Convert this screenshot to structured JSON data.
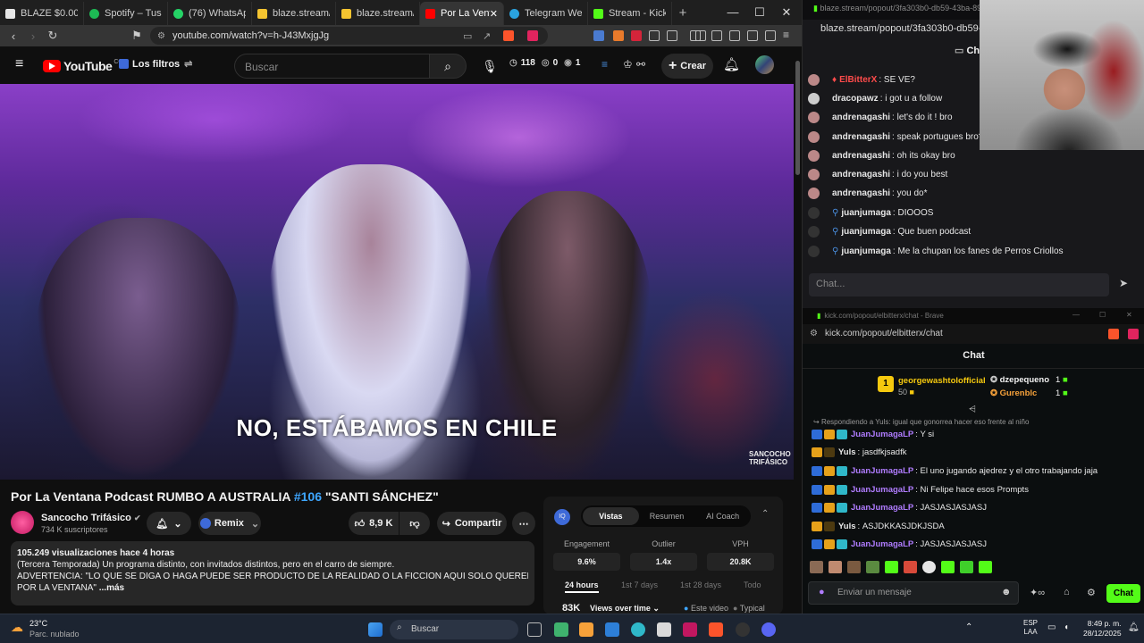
{
  "browser": {
    "tabs": [
      {
        "label": "BLAZE $0.004610",
        "color": "#e6e6e6"
      },
      {
        "label": "Spotify – Tus me",
        "color": "#1db954"
      },
      {
        "label": "(76) WhatsApp",
        "color": "#25d366"
      },
      {
        "label": "blaze.stream/stre",
        "color": "#f4c430"
      },
      {
        "label": "blaze.stream/bar",
        "color": "#f4c430"
      },
      {
        "label": "Por La Venta",
        "color": "#ff0000"
      },
      {
        "label": "Telegram Web",
        "color": "#2aa3df"
      },
      {
        "label": "Stream - Kick Da",
        "color": "#53fc18"
      }
    ],
    "url": "youtube.com/watch?v=h-J43MxjgJg"
  },
  "youtube": {
    "logo": "YouTube",
    "logo_country": "CO",
    "filters_label": "Los filtros",
    "search_placeholder": "Buscar",
    "stats": {
      "views": "118",
      "a": "0",
      "b": "1"
    },
    "create_label": "Crear",
    "video_subtitle": "NO, ESTÁBAMOS EN CHILE",
    "watermark": "SANCOCHO TRIFÁSICO",
    "title_prefix": "Por La Ventana Podcast RUMBO A AUSTRALIA ",
    "title_hashtag": "#106",
    "title_suffix": " \"SANTI SÁNCHEZ\"",
    "channel": "Sancocho Trifásico",
    "subscribers": "734 K suscriptores",
    "remix_label": "Remix",
    "likes": "8,9 K",
    "share_label": "Compartir",
    "desc_stats": "105.249 visualizaciones  hace 4 horas",
    "desc_line1": "(Tercera Temporada) Un programa distinto, con invitados distintos, pero en el carro de siempre.",
    "desc_line2": "ADVERTENCIA: \"LO QUE SE DIGA O HAGA PUEDE SER PRODUCTO DE LA REALIDAD O LA FICCION AQUI SOLO QUEREMOS QUE ENTREN",
    "desc_line3": "POR LA VENTANA\"",
    "desc_more": "...más"
  },
  "analytics": {
    "tabs": [
      "Vistas",
      "Resumen",
      "AI Coach"
    ],
    "metrics": [
      {
        "label": "Engagement",
        "value": "9.6%"
      },
      {
        "label": "Outlier",
        "value": "1.4x"
      },
      {
        "label": "VPH",
        "value": "20.8K"
      }
    ],
    "ranges": [
      "24 hours",
      "1st 7 days",
      "1st 28 days",
      "Todo"
    ],
    "total": "83K",
    "views_over_time": "Views over time",
    "legend_this": "Este video",
    "legend_typical": "Typical"
  },
  "blaze": {
    "titlebar": "blaze.stream/popout/3fa303b0-db59-43ba-89b5-96",
    "url": "blaze.stream/popout/3fa303b0-db59-43ba",
    "chat_label": "Chat",
    "messages": [
      {
        "user": "ElBitterX",
        "text": "SE VE?",
        "color": "#ff4b4b"
      },
      {
        "user": "dracopawz",
        "text": "i got u a follow",
        "color": "#e6e6e6"
      },
      {
        "user": "andrenagashi",
        "text": "let's do it ! bro",
        "color": "#e6e6e6"
      },
      {
        "user": "andrenagashi",
        "text": "speak portugues bro?",
        "color": "#e6e6e6"
      },
      {
        "user": "andrenagashi",
        "text": "oh its okay bro",
        "color": "#e6e6e6"
      },
      {
        "user": "andrenagashi",
        "text": "i do you best",
        "color": "#e6e6e6"
      },
      {
        "user": "andrenagashi",
        "text": "you do*",
        "color": "#e6e6e6"
      },
      {
        "user": "juanjumaga",
        "text": "DIOOOS",
        "color": "#e6e6e6"
      },
      {
        "user": "juanjumaga",
        "text": "Que buen podcast",
        "color": "#e6e6e6"
      },
      {
        "user": "juanjumaga",
        "text": "Me la chupan los fanes de Perros Criollos",
        "color": "#e6e6e6"
      }
    ],
    "input_placeholder": "Chat..."
  },
  "kick": {
    "titlebar": "kick.com/popout/elbitterx/chat - Brave",
    "url": "kick.com/popout/elbitterx/chat",
    "header": "Chat",
    "leaders": [
      {
        "name": "georgewashtolofficial",
        "amount": "50",
        "color": "#f6c90e"
      },
      {
        "name": "dzepequeno",
        "amount": "1",
        "color": "#e6e6e6"
      },
      {
        "name": "Gurenblc",
        "amount": "1",
        "color": "#f6a13a"
      }
    ],
    "reply_note": "Respondiendo a Yuls: igual que gonorrea hacer eso frente al niño",
    "messages": [
      {
        "user": "JuanJumagaLP",
        "text": "Y si",
        "color": "#b07cff"
      },
      {
        "user": "Yuls",
        "text": "jasdfkjsadfk",
        "color": "#e6e6e6"
      },
      {
        "user": "JuanJumagaLP",
        "text": "El uno jugando ajedrez y el otro trabajando jaja",
        "color": "#b07cff"
      },
      {
        "user": "JuanJumagaLP",
        "text": "Ni Felipe hace esos Prompts",
        "color": "#b07cff"
      },
      {
        "user": "JuanJumagaLP",
        "text": "JASJASJASJASJ",
        "color": "#b07cff"
      },
      {
        "user": "Yuls",
        "text": "ASJDKKASJDKJSDA",
        "color": "#e6e6e6"
      },
      {
        "user": "JuanJumagaLP",
        "text": "JASJASJASJASJ",
        "color": "#b07cff"
      }
    ],
    "input_placeholder": "Enviar un mensaje",
    "send_label": "Chat"
  },
  "taskbar": {
    "weather_temp": "23°C",
    "weather_desc": "Parc. nublado",
    "search_label": "Buscar",
    "lang": "ESP",
    "lang2": "LAA",
    "time": "8:49 p. m.",
    "date": "28/12/2025"
  }
}
